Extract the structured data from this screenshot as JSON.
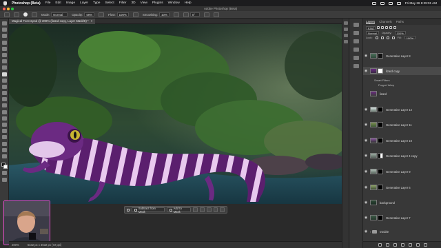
{
  "menubar": {
    "app": "Photoshop (Beta)",
    "items": [
      "File",
      "Edit",
      "Image",
      "Layer",
      "Type",
      "Select",
      "Filter",
      "3D",
      "View",
      "Plugins",
      "Window",
      "Help"
    ],
    "datetime": "Fri May 26 8:29:01 AM"
  },
  "window": {
    "title": "Adobe Photoshop (Beta)"
  },
  "options": {
    "mode_label": "Mode:",
    "mode_value": "Normal",
    "opacity_label": "Opacity:",
    "opacity_value": "59%",
    "flow_label": "Flow:",
    "flow_value": "100%",
    "smoothing_label": "Smoothing:",
    "smoothing_value": "10%",
    "angle_value": "0°"
  },
  "document": {
    "tab_label": "Magical Forest.psd @ 200% (lizard copy, Layer Mask/8) *"
  },
  "context_bar": {
    "subtract_label": "Subtract from Mask",
    "add_label": "Add to Mask"
  },
  "status": {
    "zoom": "200%",
    "doc_size": "6432 px x 3632 px (72 ppi)"
  },
  "layers_panel": {
    "tabs": [
      "Layers",
      "Channels",
      "Paths"
    ],
    "kind_label": "Kind",
    "mode_value": "Normal",
    "opacity_label": "Opacity:",
    "opacity_value": "100%",
    "lock_label": "Lock:",
    "fill_label": "Fill:",
    "fill_value": "100%",
    "layers": [
      {
        "name": "Generative Layer 8"
      },
      {
        "name": "lizard copy"
      },
      {
        "name": "Smart Filters"
      },
      {
        "name": "Puppet Warp"
      },
      {
        "name": "lizard"
      },
      {
        "name": "Generative Layer 12"
      },
      {
        "name": "Generative Layer 11"
      },
      {
        "name": "Generative Layer 10"
      },
      {
        "name": "Generative Layer 4 copy"
      },
      {
        "name": "Generative Layer 9"
      },
      {
        "name": "Generative Layer 6"
      },
      {
        "name": "background"
      },
      {
        "name": "Generative Layer 7"
      },
      {
        "name": "trouble"
      }
    ]
  }
}
